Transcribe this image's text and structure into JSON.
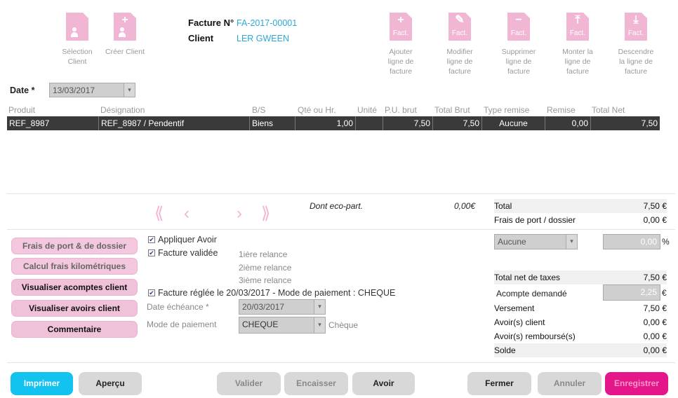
{
  "colors": {
    "accent_blue": "#13c3ef",
    "pink": "#f1b6d4",
    "save_magenta": "#e4168a",
    "row_dark": "#3a3a3a"
  },
  "top_left_actions": [
    {
      "label_l1": "Sélection",
      "label_l2": "Client",
      "icon": "client-doc-person-icon"
    },
    {
      "label_l1": "Créer Client",
      "label_l2": "",
      "icon": "client-doc-plus-icon"
    }
  ],
  "header": {
    "invoice_label": "Facture N°",
    "invoice_number": "FA-2017-00001",
    "client_label": "Client",
    "client_name": "LER GWEEN"
  },
  "line_actions": [
    {
      "l1": "Ajouter",
      "l2": "ligne de",
      "l3": "facture",
      "glyph": "+",
      "badge": "Fact."
    },
    {
      "l1": "Modifier",
      "l2": "ligne de",
      "l3": "facture",
      "glyph": "✎",
      "badge": "Fact."
    },
    {
      "l1": "Supprimer",
      "l2": "ligne de",
      "l3": "facture",
      "glyph": "−",
      "badge": "Fact."
    },
    {
      "l1": "Monter la",
      "l2": "ligne de",
      "l3": "facture",
      "glyph": "⤒",
      "badge": "Fact."
    },
    {
      "l1": "Descendre",
      "l2": "la ligne de",
      "l3": "facture",
      "glyph": "⤓",
      "badge": "Fact."
    }
  ],
  "date": {
    "label": "Date *",
    "value": "13/03/2017"
  },
  "table": {
    "headers": [
      "Produit",
      "Désignation",
      "B/S",
      "Qté ou Hr.",
      "Unité",
      "P.U. brut",
      "Total Brut",
      "Type remise",
      "Remise",
      "Total Net"
    ],
    "rows": [
      [
        "REF_8987",
        "REF_8987 / Pendentif",
        "Biens",
        "1,00",
        "",
        "7,50",
        "7,50",
        "Aucune",
        "0,00",
        "7,50"
      ]
    ]
  },
  "eco": {
    "label": "Dont eco-part.",
    "value": "0,00€"
  },
  "nav": {
    "first": "⟪",
    "prev": "‹",
    "next": "›",
    "last": "⟫"
  },
  "totals": {
    "total_label": "Total",
    "total_value": "7,50 €",
    "frais_label": "Frais de port / dossier",
    "frais_value": "0,00 €",
    "remise_type": "Aucune",
    "remise_pct": "0,00",
    "pct_sign": "%",
    "net_label": "Total net de taxes",
    "net_value": "7,50 €",
    "acompte_label": "Acompte demandé",
    "acompte_value": "2,25",
    "euro": "€",
    "versement_label": "Versement",
    "versement_value": "7,50 €",
    "avoirs_client_label": "Avoir(s) client",
    "avoirs_client_value": "0,00 €",
    "avoirs_remb_label": "Avoir(s) remboursé(s)",
    "avoirs_remb_value": "0,00 €",
    "solde_label": "Solde",
    "solde_value": "0,00 €"
  },
  "left_buttons": [
    "Frais de port & de dossier",
    "Calcul frais kilométriques",
    "Visualiser acomptes client",
    "Visualiser avoirs client",
    "Commentaire"
  ],
  "options": {
    "appliquer_avoir": "Appliquer Avoir",
    "facture_validee": "Facture validée",
    "relance1": "1ière relance",
    "relance2": "2ième relance",
    "relance3": "3ième relance",
    "facture_reglee": "Facture réglée le 20/03/2017 - Mode de paiement : CHEQUE",
    "echeance_label": "Date échéance *",
    "echeance_value": "20/03/2017",
    "mode_label": "Mode de paiement",
    "mode_value": "CHEQUE",
    "mode_text": "Chèque"
  },
  "bottom_buttons": {
    "imprimer": "Imprimer",
    "apercu": "Aperçu",
    "valider": "Valider",
    "encaisser": "Encaisser",
    "avoir": "Avoir",
    "fermer": "Fermer",
    "annuler": "Annuler",
    "enregistrer": "Enregistrer"
  }
}
